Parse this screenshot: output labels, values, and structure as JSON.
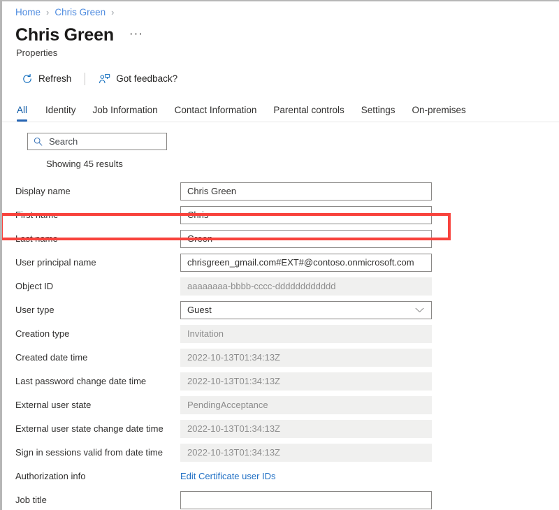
{
  "breadcrumb": {
    "items": [
      {
        "label": "Home"
      },
      {
        "label": "Chris Green"
      }
    ],
    "separator": "›"
  },
  "header": {
    "title": "Chris Green",
    "subtitle": "Properties",
    "ellipsis": "···"
  },
  "commandbar": {
    "refresh_label": "Refresh",
    "feedback_label": "Got feedback?"
  },
  "tabs": [
    {
      "label": "All",
      "active": true
    },
    {
      "label": "Identity",
      "active": false
    },
    {
      "label": "Job Information",
      "active": false
    },
    {
      "label": "Contact Information",
      "active": false
    },
    {
      "label": "Parental controls",
      "active": false
    },
    {
      "label": "Settings",
      "active": false
    },
    {
      "label": "On-premises",
      "active": false
    }
  ],
  "search": {
    "placeholder": "Search",
    "value": "",
    "results_text": "Showing 45 results"
  },
  "properties": [
    {
      "label": "Display name",
      "value": "Chris Green",
      "kind": "editable"
    },
    {
      "label": "First name",
      "value": "Chris",
      "kind": "editable"
    },
    {
      "label": "Last name",
      "value": "Green",
      "kind": "editable"
    },
    {
      "label": "User principal name",
      "value": "chrisgreen_gmail.com#EXT#@contoso.onmicrosoft.com",
      "kind": "editable"
    },
    {
      "label": "Object ID",
      "value": "aaaaaaaa-bbbb-cccc-dddddddddddd",
      "kind": "readonly"
    },
    {
      "label": "User type",
      "value": "Guest",
      "kind": "dropdown"
    },
    {
      "label": "Creation type",
      "value": "Invitation",
      "kind": "readonly"
    },
    {
      "label": "Created date time",
      "value": "2022-10-13T01:34:13Z",
      "kind": "readonly"
    },
    {
      "label": "Last password change date time",
      "value": "2022-10-13T01:34:13Z",
      "kind": "readonly"
    },
    {
      "label": "External user state",
      "value": "PendingAcceptance",
      "kind": "readonly",
      "highlighted": true
    },
    {
      "label": "External user state change date time",
      "value": "2022-10-13T01:34:13Z",
      "kind": "readonly"
    },
    {
      "label": "Sign in sessions valid from date time",
      "value": "2022-10-13T01:34:13Z",
      "kind": "readonly"
    },
    {
      "label": "Authorization info",
      "value": "Edit Certificate user IDs",
      "kind": "link"
    },
    {
      "label": "Job title",
      "value": "",
      "kind": "editable"
    }
  ],
  "colors": {
    "accent": "#0f6cbd",
    "tab_active": "#2565b5",
    "link": "#1f6fc4",
    "breadcrumb_link": "#4f8ce0",
    "highlight": "#f8423c",
    "readonly_bg": "#f0f0ef"
  }
}
